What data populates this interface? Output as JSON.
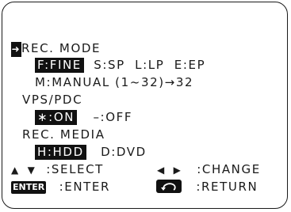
{
  "menu": {
    "rec_mode": {
      "label": "REC. MODE",
      "selected": "F:FINE",
      "options": [
        "S:SP",
        "L:LP",
        "E:EP"
      ],
      "manual": "M:MANUAL (1~32)→32"
    },
    "vps_pdc": {
      "label": "VPS/PDC",
      "selected": "∗:ON",
      "off": "–:OFF"
    },
    "rec_media": {
      "label": "REC. MEDIA",
      "selected": "H:HDD",
      "option": "D:DVD"
    }
  },
  "legend": {
    "select": ":SELECT",
    "change": ":CHANGE",
    "enter_icon": "ENTER",
    "enter": ":ENTER",
    "return": ":RETURN"
  },
  "icons": {
    "cursor": "right-arrow-icon",
    "up": "triangle-up-icon",
    "down": "triangle-down-icon",
    "left": "triangle-left-icon",
    "right": "triangle-right-icon",
    "enter": "enter-key-icon",
    "return": "return-key-icon"
  }
}
